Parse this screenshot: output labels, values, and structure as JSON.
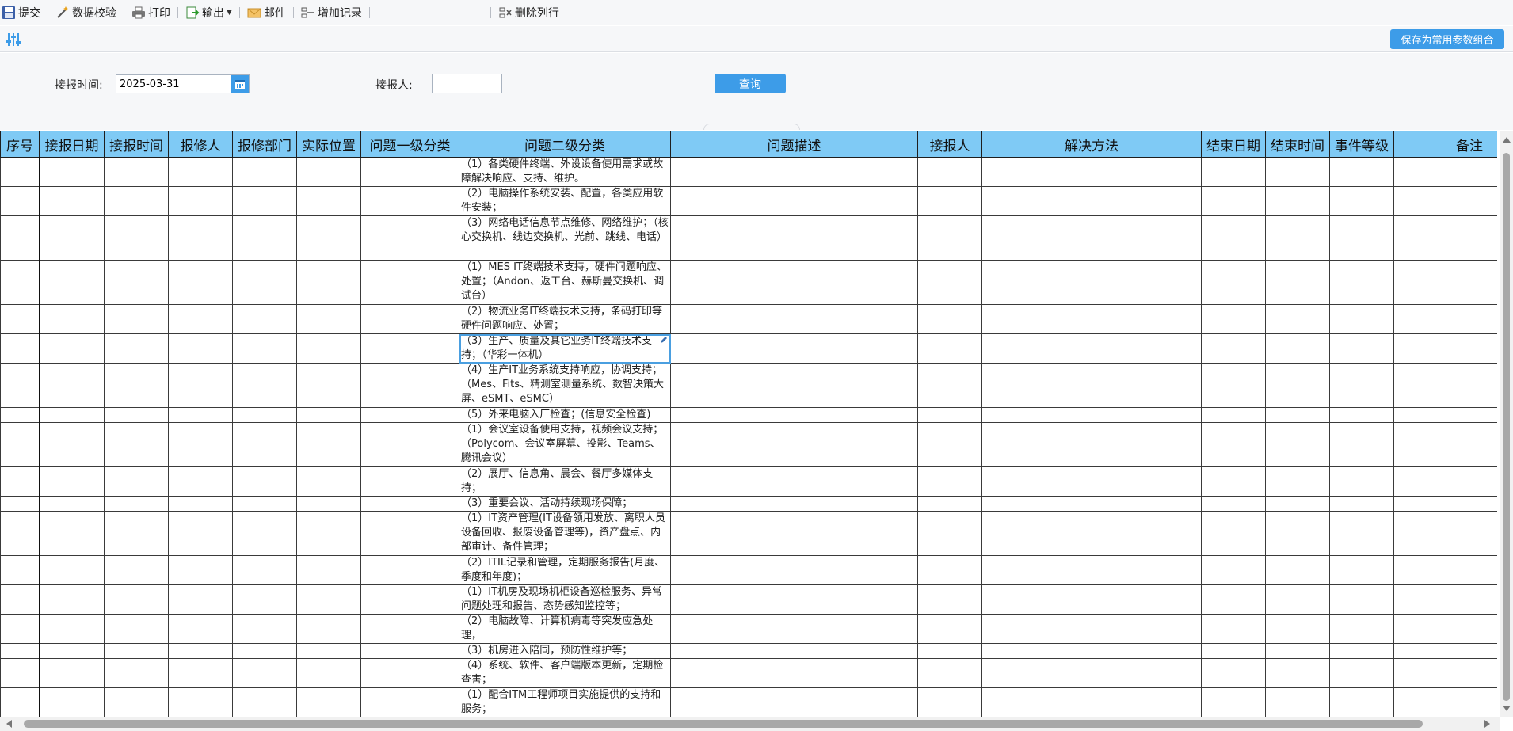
{
  "toolbar": {
    "submit": "提交",
    "validate": "数据校验",
    "print": "打印",
    "export": "输出",
    "mail": "邮件",
    "add_record": "增加记录",
    "delete_row": "删除列行"
  },
  "save_params": "保存为常用参数组合",
  "query": {
    "date_label": "接报时间:",
    "date_value": "2025-03-31",
    "reporter_label": "接报人:",
    "reporter_value": "",
    "query_button": "查询"
  },
  "table": {
    "headers": [
      "序号",
      "接报日期",
      "接报时间",
      "报修人",
      "报修部门",
      "实际位置",
      "问题一级分类",
      "问题二级分类",
      "问题描述",
      "接报人",
      "解决方法",
      "结束日期",
      "结束时间",
      "事件等级",
      "备注"
    ],
    "rows": [
      "（1）各类硬件终端、外设设备使用需求或故障解决响应、支持、维护。",
      "（2）电脑操作系统安装、配置，各类应用软件安装；",
      "（3）网络电话信息节点维修、网络维护；（核心交换机、线边交换机、光前、跳线、电话）",
      "（1）MES IT终端技术支持，硬件问题响应、处置；（Andon、返工台、赫斯曼交换机、调试台）",
      "（2）物流业务IT终端技术支持，条码打印等硬件问题响应、处置；",
      "（3）生产、质量及其它业务IT终端技术支持；（华彩一体机）",
      "（4）生产IT业务系统支持响应，协调支持；（Mes、Fits、精测室测量系统、数智决策大屏、eSMT、eSMC）",
      "（5）外来电脑入厂检查；(信息安全检查)",
      "（1）会议室设备使用支持，视频会议支持；（Polycom、会议室屏幕、投影、Teams、腾讯会议）",
      "（2）展厅、信息角、晨会、餐厅多媒体支持；",
      "（3）重要会议、活动持续现场保障；",
      "（1）IT资产管理(IT设备领用发放、离职人员设备回收、报废设备管理等)，资产盘点、内部审计、备件管理；",
      "（2）ITIL记录和管理，定期服务报告(月度、季度和年度)；",
      "（1）IT机房及现场机柜设备巡检服务、异常问题处理和报告、态势感知监控等；",
      "（2）电脑故障、计算机病毒等突发应急处理，",
      "（3）机房进入陪同，预防性维护等；",
      "（4）系统、软件、客户端版本更新，定期检查害；",
      "（1）配合ITM工程师项目实施提供的支持和服务；"
    ]
  }
}
